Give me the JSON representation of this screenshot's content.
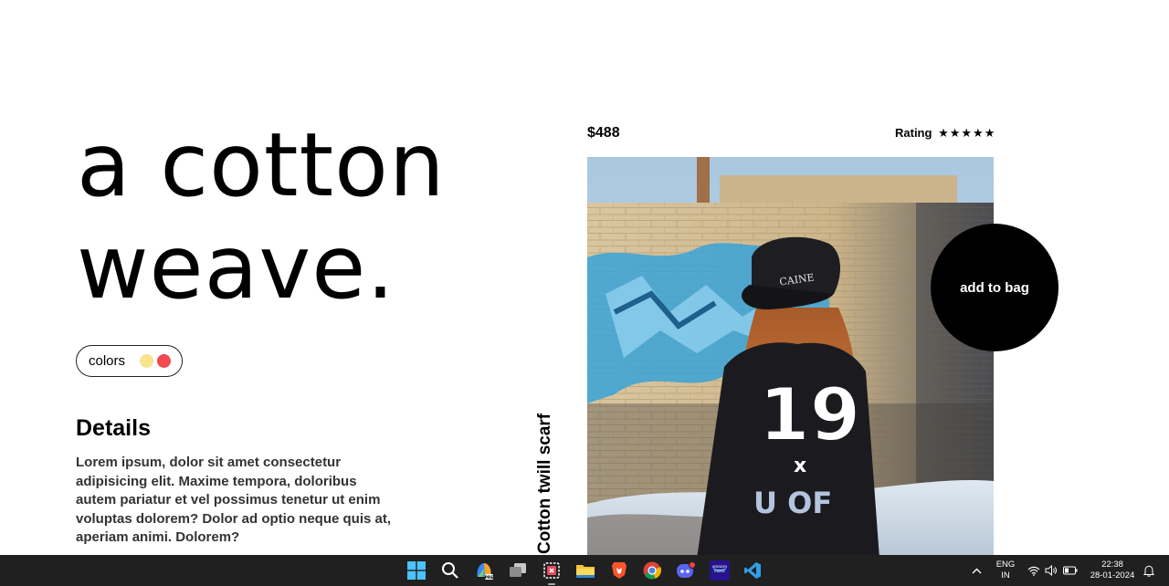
{
  "hero": {
    "line1": "a cotton",
    "line2": "weave."
  },
  "colors": {
    "label": "colors",
    "swatches": [
      "#f9e38f",
      "#f24a4f"
    ]
  },
  "details": {
    "title": "Details",
    "body": "Lorem ipsum, dolor sit amet consectetur adipisicing elit. Maxime tempora, doloribus autem pariatur et vel possimus tenetur ut enim voluptas dolorem? Dolor ad optio neque quis at, aperiam animi. Dolorem?"
  },
  "product": {
    "name": "Cotton twill scarf",
    "price": "$488",
    "rating_label": "Rating",
    "rating_stars": "★★★★★",
    "rating_value": 5,
    "rating_max": 5,
    "add_to_bag": "add to bag"
  },
  "taskbar": {
    "icons": [
      "windows-start-icon",
      "search-icon",
      "copilot-icon",
      "task-view-icon",
      "snipping-tool-icon",
      "file-explorer-icon",
      "brave-icon",
      "chrome-icon",
      "discord-icon",
      "amazon-music-icon",
      "vscode-icon"
    ],
    "amazon_music_text": "amazon music",
    "lang_line1": "ENG",
    "lang_line2": "IN",
    "time": "22:38",
    "date": "28-01-2024"
  }
}
